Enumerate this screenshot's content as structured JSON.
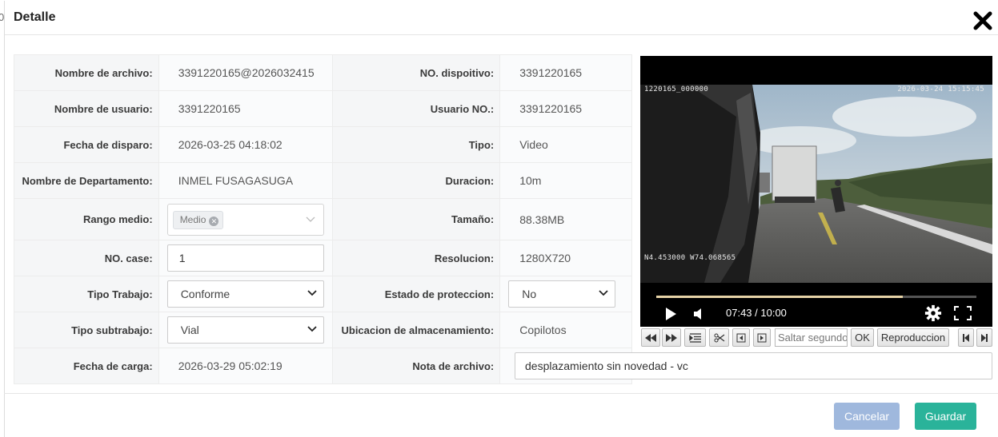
{
  "edge_char": "0",
  "dialog": {
    "title": "Detalle"
  },
  "rows": {
    "nombre_archivo": {
      "label": "Nombre de archivo:",
      "value": "3391220165@2026032415"
    },
    "no_dispositivo": {
      "label": "NO. dispoitivo:",
      "value": "3391220165"
    },
    "nombre_usuario": {
      "label": "Nombre de usuario:",
      "value": "3391220165"
    },
    "usuario_no": {
      "label": "Usuario NO.:",
      "value": "3391220165"
    },
    "fecha_disparo": {
      "label": "Fecha de disparo:",
      "value": "2026-03-25 04:18:02"
    },
    "tipo": {
      "label": "Tipo:",
      "value": "Video"
    },
    "departamento": {
      "label": "Nombre de Departamento:",
      "value": "INMEL FUSAGASUGA"
    },
    "duracion": {
      "label": "Duracion:",
      "value": "10m"
    },
    "rango_medio": {
      "label": "Rango medio:",
      "tag": "Medio"
    },
    "tamano": {
      "label": "Tamaño:",
      "value": "88.38MB"
    },
    "no_case": {
      "label": "NO. case:",
      "value": "1"
    },
    "resolucion": {
      "label": "Resolucion:",
      "value": "1280X720"
    },
    "tipo_trabajo": {
      "label": "Tipo Trabajo:",
      "value": "Conforme"
    },
    "estado_proteccion": {
      "label": "Estado de proteccion:",
      "value": "No"
    },
    "tipo_subtrabajo": {
      "label": "Tipo subtrabajo:",
      "value": "Vial"
    },
    "ubicacion": {
      "label": "Ubicacion de almacenamiento:",
      "value": "Copilotos"
    },
    "fecha_carga": {
      "label": "Fecha de carga:",
      "value": "2026-03-29 05:02:19"
    },
    "nota_archivo": {
      "label": "Nota de archivo:",
      "value": "desplazamiento sin novedad - vc"
    }
  },
  "player": {
    "osd_top_left": "1220165_000000",
    "osd_top_right": "2026-03-24  15:15:45",
    "osd_bottom_left": "N4.453000  W74.068565",
    "time": "07:43 / 10:00",
    "progress": 0.77
  },
  "toolbar": {
    "seek_placeholder": "Saltar segundo",
    "ok_label": "OK",
    "playback_label": "Reproduccion"
  },
  "footer": {
    "cancel_label": "Cancelar",
    "save_label": "Guardar"
  }
}
